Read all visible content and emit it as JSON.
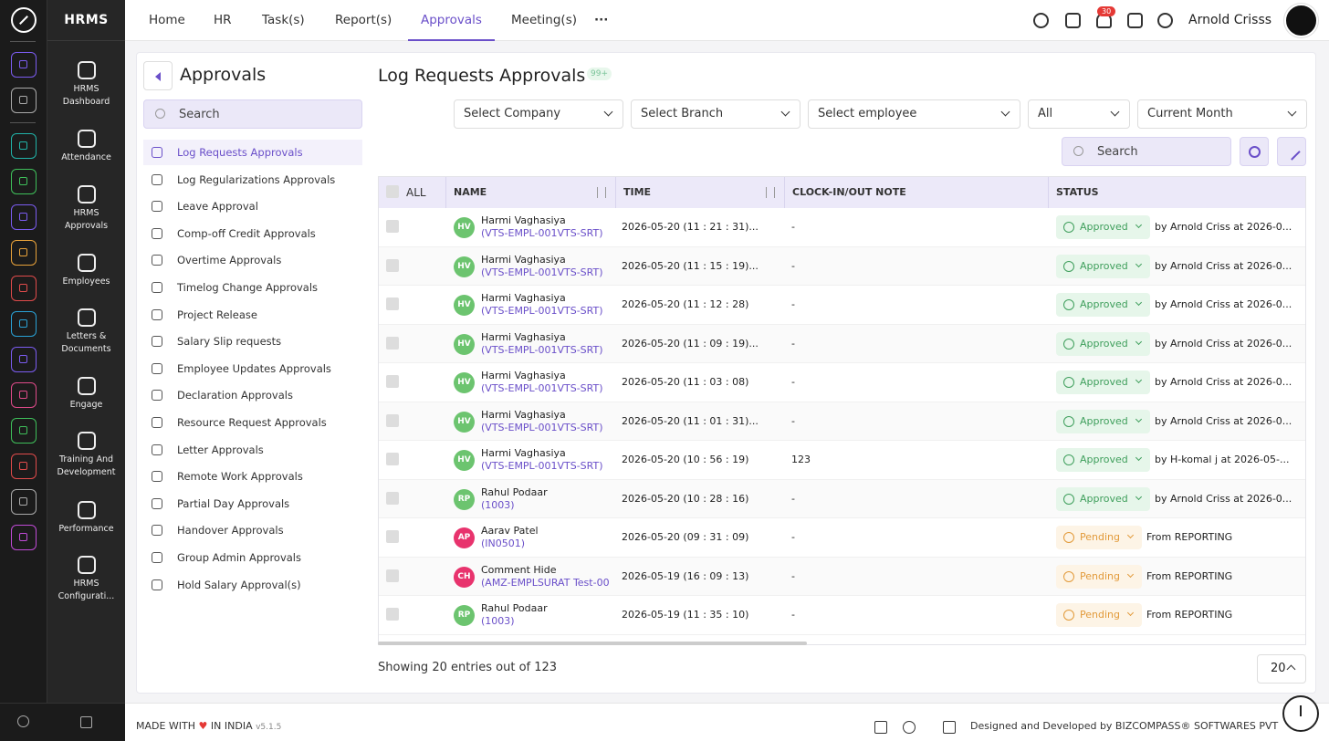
{
  "app": {
    "brand": "HRMS"
  },
  "rail_icons": [
    {
      "name": "home-icon",
      "color": "#7b5cf0"
    },
    {
      "name": "pin-icon",
      "color": "#aaaaaa"
    },
    {
      "name": "people-icon",
      "color": "#21b3a8"
    },
    {
      "name": "leaf-icon",
      "color": "#3fbf5a"
    },
    {
      "name": "briefcase-icon",
      "color": "#7b5cf0"
    },
    {
      "name": "hand-icon",
      "color": "#e8a23a"
    },
    {
      "name": "target-icon",
      "color": "#e04b4b"
    },
    {
      "name": "book-icon",
      "color": "#2aa2d6"
    },
    {
      "name": "chart-icon",
      "color": "#7b5cf0"
    },
    {
      "name": "monitor-icon",
      "color": "#e04b8a"
    },
    {
      "name": "file-icon",
      "color": "#3fbf5a"
    },
    {
      "name": "award-icon",
      "color": "#e04b4b"
    },
    {
      "name": "house-icon",
      "color": "#aaaaaa"
    },
    {
      "name": "settings-hex-icon",
      "color": "#c04bd6"
    }
  ],
  "modules": [
    {
      "label": "HRMS Dashboard",
      "icon": "dashboard-icon"
    },
    {
      "label": "Attendance",
      "icon": "calendar-clock-icon"
    },
    {
      "label": "HRMS Approvals",
      "icon": "user-check-icon"
    },
    {
      "label": "Employees",
      "icon": "user-icon"
    },
    {
      "label": "Letters & Documents",
      "icon": "letter-icon"
    },
    {
      "label": "Engage",
      "icon": "handshake-icon"
    },
    {
      "label": "Training And Development",
      "icon": "trainer-icon"
    },
    {
      "label": "Performance",
      "icon": "trend-icon"
    },
    {
      "label": "HRMS Configurati...",
      "icon": "gear-icon"
    }
  ],
  "topnav": {
    "items": [
      "Home",
      "HR",
      "Task(s)",
      "Report(s)",
      "Approvals",
      "Meeting(s)"
    ],
    "active": "Approvals",
    "notification_count": "30",
    "user_name": "Arnold Crisss"
  },
  "left": {
    "title": "Approvals",
    "search_placeholder": "Search",
    "menu": [
      "Log Requests Approvals",
      "Log Regularizations Approvals",
      "Leave Approval",
      "Comp-off Credit Approvals",
      "Overtime Approvals",
      "Timelog Change Approvals",
      "Project Release",
      "Salary Slip requests",
      "Employee Updates Approvals",
      "Declaration Approvals",
      "Resource Request Approvals",
      "Letter Approvals",
      "Remote Work Approvals",
      "Partial Day Approvals",
      "Handover Approvals",
      "Group Admin Approvals",
      "Hold Salary Approval(s)"
    ],
    "selected": "Log Requests Approvals"
  },
  "main": {
    "title": "Log Requests Approvals",
    "count_badge": "99+",
    "filters": [
      "Select Company",
      "Select Branch",
      "Select employee",
      "All",
      "Current Month"
    ],
    "search_placeholder": "Search",
    "columns": [
      "ALL",
      "NAME",
      "TIME",
      "CLOCK-IN/OUT NOTE",
      "STATUS"
    ],
    "rows": [
      {
        "initials": "HV",
        "avatar_color": "#6cc46f",
        "name": "Harmi Vaghasiya",
        "code": "(VTS-EMPL-001VTS-SRT)",
        "time": "2026-05-20 (11 : 21 : 31)...",
        "note": "-",
        "status": "Approved",
        "by": "by Arnold Criss at 2026-0..."
      },
      {
        "initials": "HV",
        "avatar_color": "#6cc46f",
        "name": "Harmi Vaghasiya",
        "code": "(VTS-EMPL-001VTS-SRT)",
        "time": "2026-05-20 (11 : 15 : 19)...",
        "note": "-",
        "status": "Approved",
        "by": "by Arnold Criss at 2026-0..."
      },
      {
        "initials": "HV",
        "avatar_color": "#6cc46f",
        "name": "Harmi Vaghasiya",
        "code": "(VTS-EMPL-001VTS-SRT)",
        "time": "2026-05-20 (11 : 12 : 28)",
        "note": "-",
        "status": "Approved",
        "by": "by Arnold Criss at 2026-0..."
      },
      {
        "initials": "HV",
        "avatar_color": "#6cc46f",
        "name": "Harmi Vaghasiya",
        "code": "(VTS-EMPL-001VTS-SRT)",
        "time": "2026-05-20 (11 : 09 : 19)...",
        "note": "-",
        "status": "Approved",
        "by": "by Arnold Criss at 2026-0..."
      },
      {
        "initials": "HV",
        "avatar_color": "#6cc46f",
        "name": "Harmi Vaghasiya",
        "code": "(VTS-EMPL-001VTS-SRT)",
        "time": "2026-05-20 (11 : 03 : 08)",
        "note": "-",
        "status": "Approved",
        "by": "by Arnold Criss at 2026-0..."
      },
      {
        "initials": "HV",
        "avatar_color": "#6cc46f",
        "name": "Harmi Vaghasiya",
        "code": "(VTS-EMPL-001VTS-SRT)",
        "time": "2026-05-20 (11 : 01 : 31)...",
        "note": "-",
        "status": "Approved",
        "by": "by Arnold Criss at 2026-0..."
      },
      {
        "initials": "HV",
        "avatar_color": "#6cc46f",
        "name": "Harmi Vaghasiya",
        "code": "(VTS-EMPL-001VTS-SRT)",
        "time": "2026-05-20 (10 : 56 : 19)",
        "note": "123",
        "status": "Approved",
        "by": "by H-komal j at 2026-05-..."
      },
      {
        "initials": "RP",
        "avatar_color": "#6cc46f",
        "name": "Rahul Podaar",
        "code": "(1003)",
        "time": "2026-05-20 (10 : 28 : 16)",
        "note": "-",
        "status": "Approved",
        "by": "by Arnold Criss at 2026-0..."
      },
      {
        "initials": "AP",
        "avatar_color": "#e8336d",
        "name": "Aarav Patel",
        "code": "(IN0501)",
        "time": "2026-05-20 (09 : 31 : 09)",
        "note": "-",
        "status": "Pending",
        "by": "From REPORTING"
      },
      {
        "initials": "CH",
        "avatar_color": "#e8336d",
        "name": "Comment Hide",
        "code": "(AMZ-EMPLSURAT Test-00",
        "time": "2026-05-19 (16 : 09 : 13)",
        "note": "-",
        "status": "Pending",
        "by": "From REPORTING"
      },
      {
        "initials": "RP",
        "avatar_color": "#6cc46f",
        "name": "Rahul Podaar",
        "code": "(1003)",
        "time": "2026-05-19 (11 : 35 : 10)",
        "note": "-",
        "status": "Pending",
        "by": "From REPORTING"
      }
    ],
    "showing": "Showing 20 entries out of 123",
    "page_size": "20"
  },
  "footer": {
    "made_pre": "MADE WITH",
    "made_post": "IN INDIA",
    "version": "v5.1.5",
    "developed": "Designed and Developed by  BIZCOMPASS® SOFTWARES PVT"
  }
}
